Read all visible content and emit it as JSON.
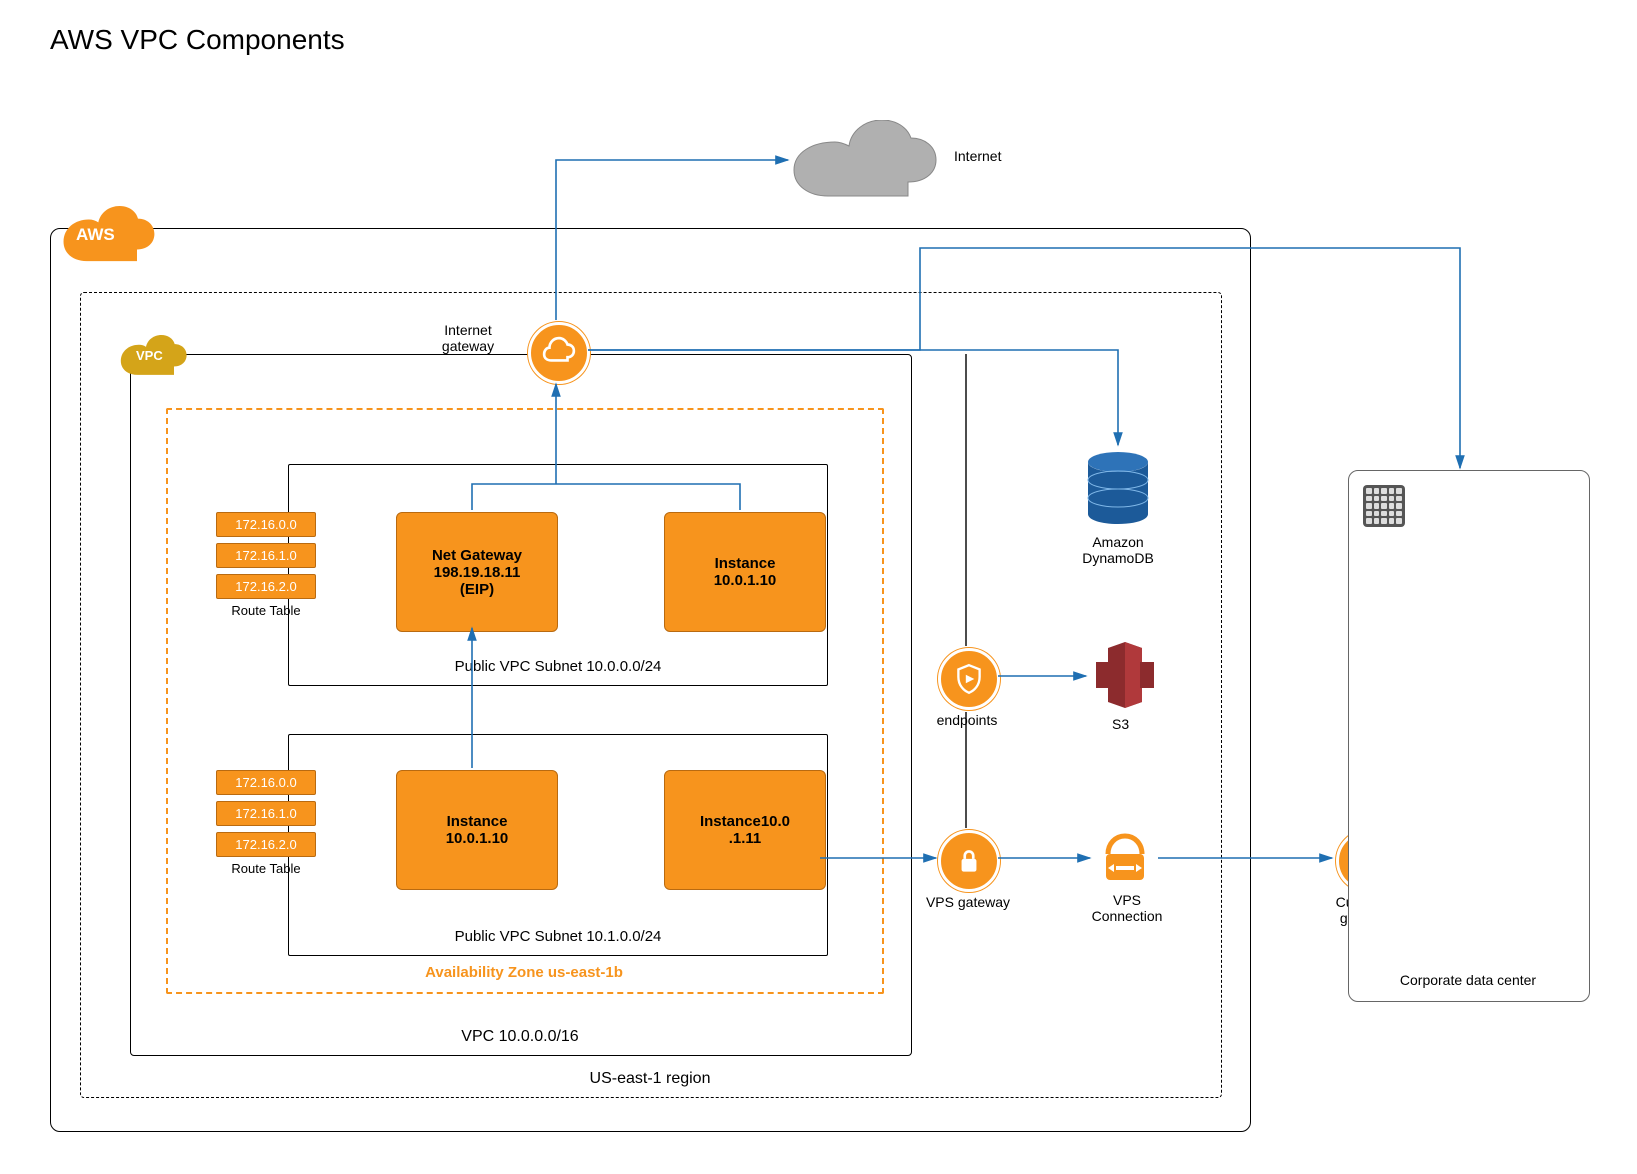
{
  "title": "AWS VPC Components",
  "aws_label": "AWS",
  "vpc_label": "VPC",
  "region_label": "US-east-1 region",
  "vpc_box_label": "VPC 10.0.0.0/16",
  "vpc_cidr": "10.0.0.0/16",
  "az_label": "Availability Zone us-east-1b",
  "availability_zone": "us-east-1b",
  "internet_gateway": {
    "label_line1": "Internet",
    "label_line2": "gateway"
  },
  "internet_label": "Internet",
  "subnets": [
    {
      "label": "Public VPC Subnet 10.0.0.0/24",
      "cidr": "10.0.0.0/24",
      "nodes": {
        "net_gateway": {
          "line1": "Net Gateway",
          "line2": "198.19.18.11",
          "line3": "(EIP)"
        },
        "instance": {
          "line1": "Instance",
          "line2": "10.0.1.10"
        }
      }
    },
    {
      "label": "Public VPC Subnet 10.1.0.0/24",
      "cidr": "10.1.0.0/24",
      "nodes": {
        "instance_a": {
          "line1": "Instance",
          "line2": "10.0.1.10"
        },
        "instance_b": {
          "line1": "Instance10.0",
          "line2": ".1.11"
        }
      }
    }
  ],
  "route_tables": {
    "caption": "Route Table",
    "rows": [
      "172.16.0.0",
      "172.16.1.0",
      "172.16.2.0"
    ]
  },
  "services": {
    "dynamodb": {
      "line1": "Amazon",
      "line2": "DynamoDB"
    },
    "endpoints_label": "endpoints",
    "s3_label": "S3",
    "vps_gateway_label": "VPS gateway",
    "vps_connection": {
      "line1": "VPS",
      "line2": "Connection"
    },
    "customer_gateway": {
      "line1": "Customer",
      "line2": "gateway"
    }
  },
  "corporate_dc_label": "Corporate data center",
  "colors": {
    "orange": "#F7941D",
    "yellow": "#D4A419",
    "arrow": "#1F6FB2",
    "dynamodb": "#2E73B8",
    "s3": "#B0393B",
    "grey_cloud": "#B0B0B0"
  }
}
